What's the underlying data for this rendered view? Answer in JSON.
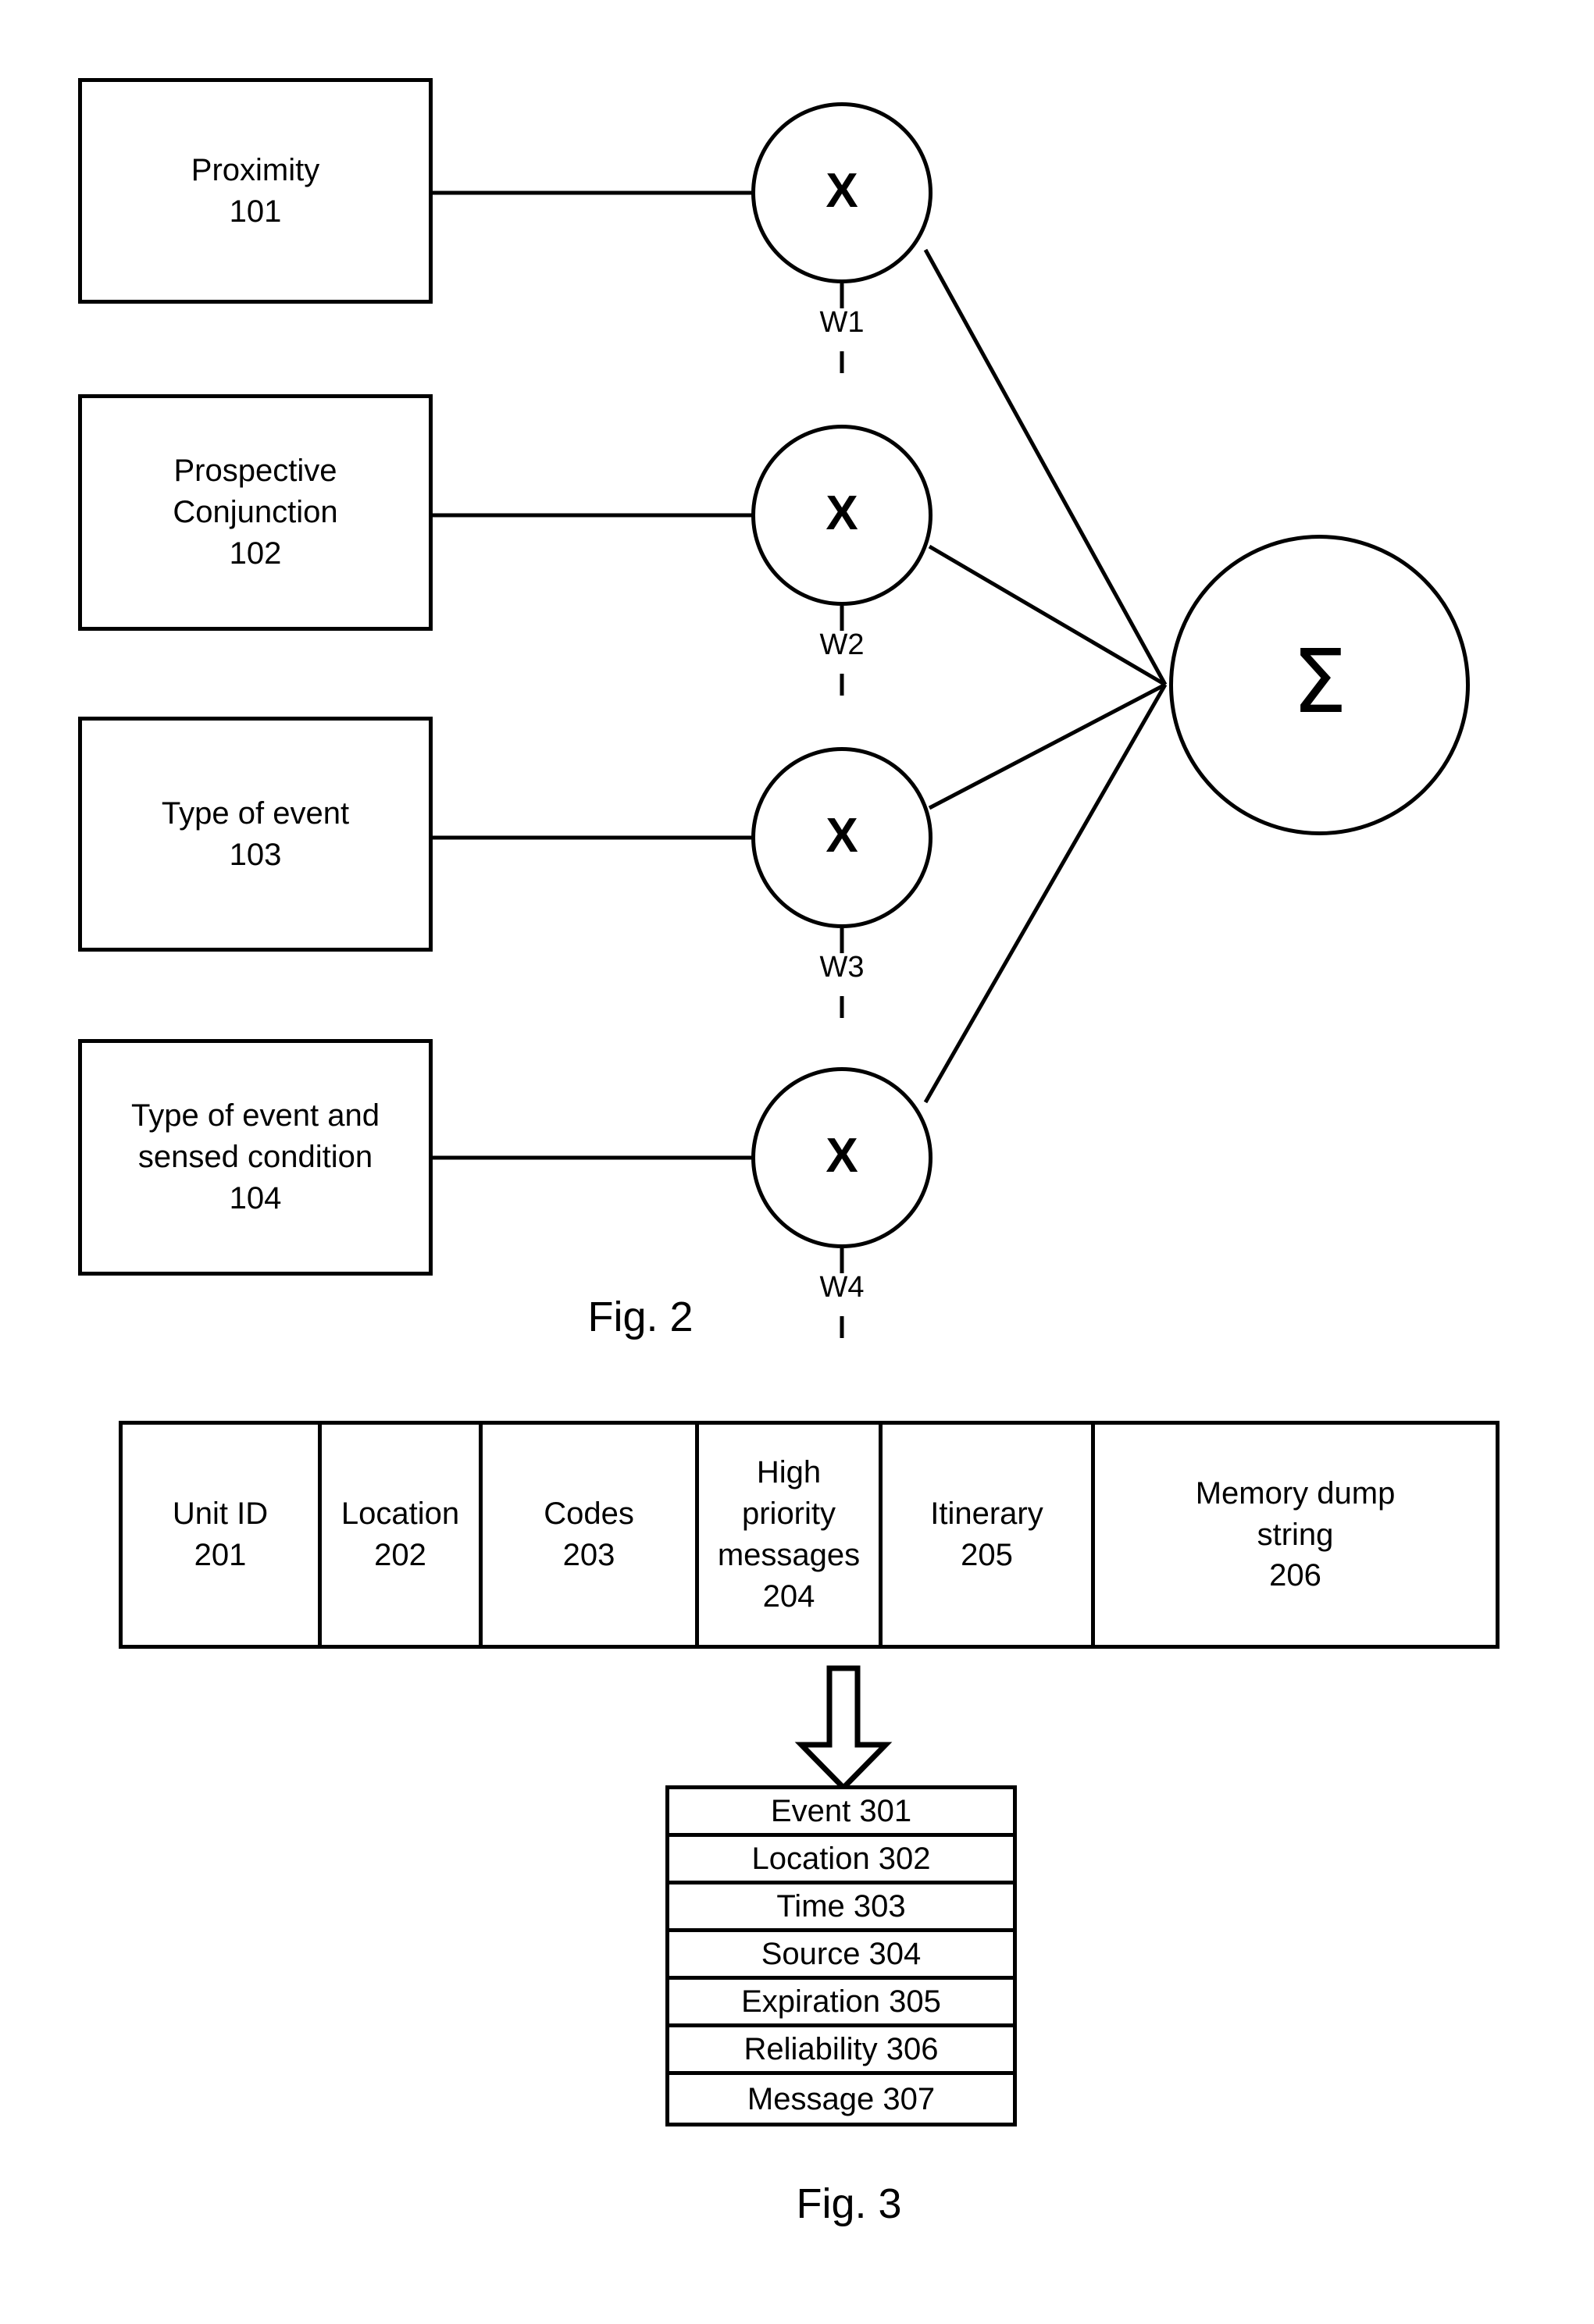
{
  "figure2": {
    "caption": "Fig. 2",
    "sum_glyph": "Σ",
    "multiply_glyph": "X",
    "inputs": [
      {
        "label": "Proximity\n101"
      },
      {
        "label": "Prospective\nConjunction\n102"
      },
      {
        "label": "Type of event\n103"
      },
      {
        "label": "Type of event and\nsensed condition\n104"
      }
    ],
    "weights": [
      {
        "label": "W1"
      },
      {
        "label": "W2"
      },
      {
        "label": "W3"
      },
      {
        "label": "W4"
      }
    ]
  },
  "figure3": {
    "caption": "Fig. 3",
    "record_cells": [
      {
        "label": "Unit ID\n201"
      },
      {
        "label": "Location\n202"
      },
      {
        "label": "Codes\n203"
      },
      {
        "label": "High\npriority\nmessages\n204"
      },
      {
        "label": "Itinerary\n205"
      },
      {
        "label": "Memory dump\nstring\n206"
      }
    ],
    "message_fields": [
      {
        "label": "Event 301"
      },
      {
        "label": "Location 302"
      },
      {
        "label": "Time 303"
      },
      {
        "label": "Source 304"
      },
      {
        "label": "Expiration 305"
      },
      {
        "label": "Reliability 306"
      },
      {
        "label": "Message 307"
      }
    ]
  },
  "colors": {
    "stroke": "#000000",
    "background": "#ffffff"
  }
}
